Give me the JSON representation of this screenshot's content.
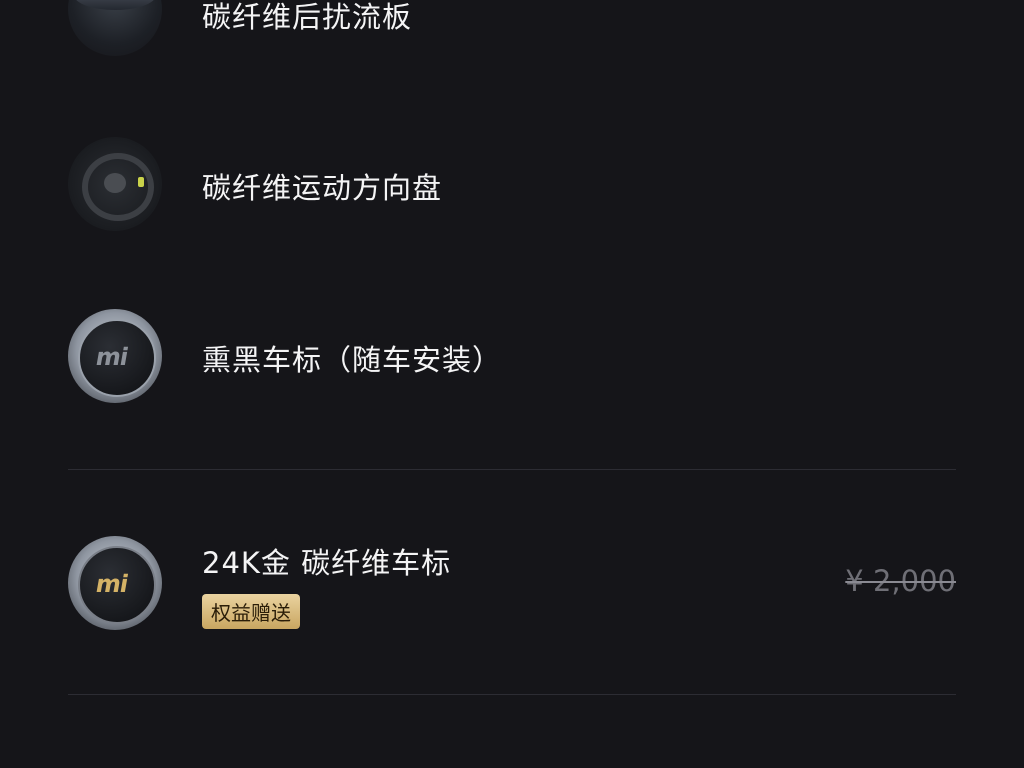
{
  "items": [
    {
      "title": "碳纤维后扰流板",
      "thumb_icon": "rear-spoiler-image"
    },
    {
      "title": "碳纤维运动方向盘",
      "thumb_icon": "steering-wheel-image"
    },
    {
      "title": "熏黑车标（随车安装）",
      "thumb_icon": "black-emblem-image"
    }
  ],
  "gift_item": {
    "title": "24K金 碳纤维车标",
    "badge": "权益赠送",
    "original_price": "¥ 2,000",
    "thumb_icon": "gold-emblem-image"
  },
  "colors": {
    "background": "#151519",
    "badge_gold": "#d9bc7f",
    "strikethrough_price": "#6f6f76"
  }
}
